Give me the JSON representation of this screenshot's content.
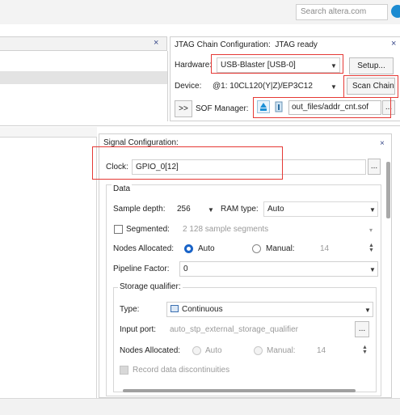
{
  "topbar": {
    "search_placeholder": "Search altera.com"
  },
  "jtag": {
    "title": "JTAG Chain Configuration:",
    "status": "JTAG ready",
    "hardware_label": "Hardware:",
    "hardware_value": "USB-Blaster [USB-0]",
    "setup_button": "Setup...",
    "device_label": "Device:",
    "device_value": "@1: 10CL120(Y|Z)/EP3C12",
    "scan_chain_button": "Scan Chain",
    "sof_toggle": ">>",
    "sof_label": "SOF Manager:",
    "sof_file": "out_files/addr_cnt.sof",
    "browse": "..."
  },
  "signal": {
    "title": "Signal Configuration:",
    "clock_label": "Clock:",
    "clock_value": "GPIO_0[12]",
    "clock_browse": "...",
    "data_group": "Data",
    "sample_depth_label": "Sample depth:",
    "sample_depth_value": "256",
    "ram_type_label": "RAM type:",
    "ram_type_value": "Auto",
    "segmented_label": "Segmented:",
    "segmented_value": "2  128 sample segments",
    "nodes_allocated_label": "Nodes Allocated:",
    "auto_label": "Auto",
    "manual_label": "Manual:",
    "manual_value": "14",
    "pipeline_label": "Pipeline Factor:",
    "pipeline_value": "0",
    "storage_group": "Storage qualifier:",
    "type_label": "Type:",
    "type_value": "Continuous",
    "input_port_label": "Input port:",
    "input_port_value": "auto_stp_external_storage_qualifier",
    "input_port_browse": "...",
    "sq_nodes_label": "Nodes Allocated:",
    "sq_auto_label": "Auto",
    "sq_manual_label": "Manual:",
    "sq_manual_value": "14",
    "record_label": "Record data discontinuities"
  },
  "colors": {
    "highlight_box": "#e53935",
    "accent": "#1a64c8"
  }
}
